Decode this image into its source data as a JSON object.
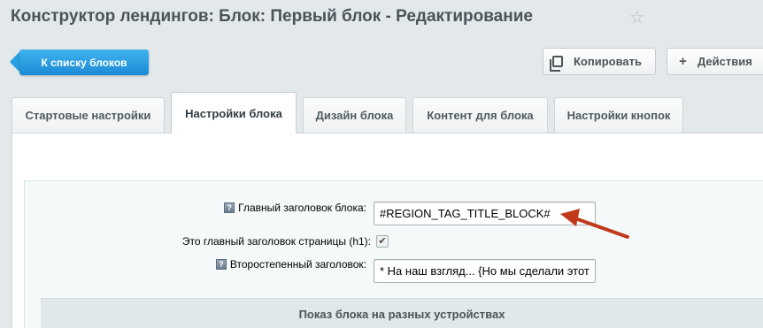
{
  "header": {
    "title": "Конструктор лендингов: Блок: Первый блок - Редактирование",
    "favorite_icon": "star-icon"
  },
  "toolbar": {
    "back_label": "К списку блоков",
    "copy_label": "Копировать",
    "actions_label": "Действия",
    "actions_icon": "plus-icon"
  },
  "tabs": [
    {
      "label": "Стартовые настройки",
      "active": false
    },
    {
      "label": "Настройки блока",
      "active": true
    },
    {
      "label": "Дизайн блока",
      "active": false
    },
    {
      "label": "Контент для блока",
      "active": false
    },
    {
      "label": "Настройки кнопок",
      "active": false
    }
  ],
  "form": {
    "main_title_label": "Главный заголовок блока:",
    "main_title_value": "#REGION_TAG_TITLE_BLOCK#",
    "h1_label": "Это главный заголовок страницы (h1):",
    "h1_checked": true,
    "subtitle_label": "Второстепенный заголовок:",
    "subtitle_value": "* На наш взгляд... {Но мы сделали этот",
    "help_icon": "?"
  },
  "section": {
    "devices_title": "Показ блока на разных устройствах"
  },
  "colors": {
    "accent_button": "#1c8ad6",
    "annotation_arrow": "#c0391b"
  }
}
